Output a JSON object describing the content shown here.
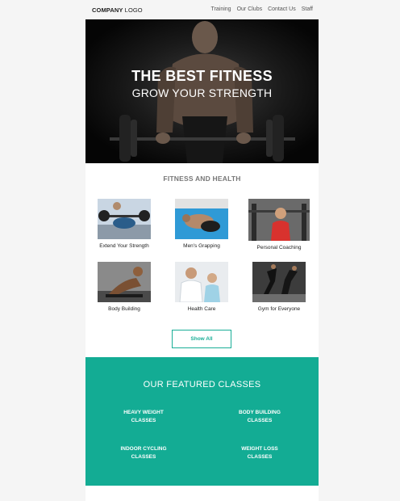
{
  "header": {
    "logo_bold": "COMPANY",
    "logo_rest": " LOGO",
    "nav": [
      {
        "label": "Training"
      },
      {
        "label": "Our Clubs"
      },
      {
        "label": "Contact Us"
      },
      {
        "label": "Staff"
      }
    ]
  },
  "hero": {
    "line1": "THE BEST FITNESS",
    "line2": "GROW YOUR STRENGTH"
  },
  "services": {
    "title": "FITNESS AND HEALTH",
    "items": [
      {
        "label": "Extend Your Strength",
        "image": "bench-press-photo"
      },
      {
        "label": "Men's Grapping",
        "image": "grappling-photo"
      },
      {
        "label": "Personal Coaching",
        "image": "coaching-photo"
      },
      {
        "label": "Body Building",
        "image": "body-building-photo"
      },
      {
        "label": "Health Care",
        "image": "health-care-photo"
      },
      {
        "label": "Gym for Everyone",
        "image": "gym-everyone-photo"
      }
    ],
    "show_all": "Show All"
  },
  "featured": {
    "title": "OUR FEATURED CLASSES",
    "classes": [
      {
        "line1": "HEAVY WEIGHT",
        "line2": "CLASSES"
      },
      {
        "line1": "BODY BUILDING",
        "line2": "CLASSES"
      },
      {
        "line1": "INDOOR CYCLING",
        "line2": "CLASSES"
      },
      {
        "line1": "WEIGHT LOSS",
        "line2": "CLASSES"
      }
    ]
  },
  "colors": {
    "accent": "#13ac94",
    "hero_bg": "#0b0b0b",
    "page_bg": "#f5f5f5"
  }
}
